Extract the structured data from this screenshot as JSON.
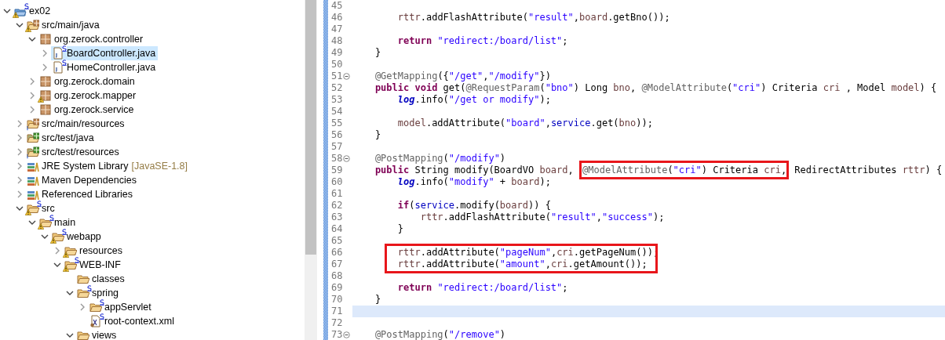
{
  "explorer": {
    "tree": [
      {
        "label": "ex02",
        "kind": "project",
        "expanded": true,
        "selected": false,
        "warning": true,
        "spring": true,
        "children": [
          {
            "label": "src/main/java",
            "kind": "source-folder",
            "expanded": true,
            "selected": false,
            "warning": true,
            "spring": false,
            "info": false,
            "children": [
              {
                "label": "org.zerock.controller",
                "kind": "package",
                "expanded": true,
                "selected": false,
                "warning": false,
                "spring": false,
                "children": [
                  {
                    "label": "BoardController.java",
                    "kind": "java-file",
                    "expanded": false,
                    "selected": true,
                    "warning": false,
                    "spring": true
                  },
                  {
                    "label": "HomeController.java",
                    "kind": "java-file",
                    "expanded": false,
                    "selected": false,
                    "warning": false,
                    "spring": true
                  }
                ]
              },
              {
                "label": "org.zerock.domain",
                "kind": "package",
                "expanded": false,
                "selected": false,
                "warning": false,
                "spring": false
              },
              {
                "label": "org.zerock.mapper",
                "kind": "package",
                "expanded": false,
                "selected": false,
                "warning": true,
                "spring": false
              },
              {
                "label": "org.zerock.service",
                "kind": "package",
                "expanded": false,
                "selected": false,
                "warning": false,
                "spring": false
              }
            ]
          },
          {
            "label": "src/main/resources",
            "kind": "source-folder",
            "expanded": false,
            "selected": false,
            "warning": false,
            "spring": false,
            "info": true
          },
          {
            "label": "src/test/java",
            "kind": "test-folder",
            "expanded": false,
            "selected": false,
            "warning": false,
            "spring": false,
            "info": false
          },
          {
            "label": "src/test/resources",
            "kind": "test-folder",
            "expanded": false,
            "selected": false,
            "warning": false,
            "spring": false,
            "info": true
          },
          {
            "label": "JRE System Library",
            "decoration": "[JavaSE-1.8]",
            "kind": "library",
            "expanded": false,
            "selected": false,
            "warning": false,
            "spring": false
          },
          {
            "label": "Maven Dependencies",
            "kind": "library",
            "expanded": false,
            "selected": false,
            "warning": false,
            "spring": false
          },
          {
            "label": "Referenced Libraries",
            "kind": "library",
            "expanded": false,
            "selected": false,
            "warning": false,
            "spring": false
          },
          {
            "label": "src",
            "kind": "folder",
            "expanded": true,
            "selected": false,
            "warning": true,
            "spring": true,
            "children": [
              {
                "label": "main",
                "kind": "folder",
                "expanded": true,
                "selected": false,
                "warning": true,
                "spring": true,
                "children": [
                  {
                    "label": "webapp",
                    "kind": "folder",
                    "expanded": true,
                    "selected": false,
                    "warning": true,
                    "spring": true,
                    "children": [
                      {
                        "label": "resources",
                        "kind": "folder",
                        "expanded": false,
                        "selected": false,
                        "warning": true,
                        "spring": false
                      },
                      {
                        "label": "WEB-INF",
                        "kind": "folder",
                        "expanded": true,
                        "selected": false,
                        "warning": true,
                        "spring": true,
                        "children": [
                          {
                            "label": "classes",
                            "kind": "folder",
                            "selected": false,
                            "warning": false,
                            "spring": false
                          },
                          {
                            "label": "spring",
                            "kind": "folder",
                            "expanded": true,
                            "selected": false,
                            "warning": false,
                            "spring": true,
                            "children": [
                              {
                                "label": "appServlet",
                                "kind": "folder",
                                "expanded": false,
                                "selected": false,
                                "warning": false,
                                "spring": true
                              },
                              {
                                "label": "root-context.xml",
                                "kind": "xml-file",
                                "selected": false,
                                "warning": false,
                                "spring": true
                              }
                            ]
                          },
                          {
                            "label": "views",
                            "kind": "folder",
                            "expanded": true,
                            "selected": false,
                            "warning": false,
                            "spring": false
                          }
                        ]
                      }
                    ]
                  }
                ]
              }
            ]
          }
        ]
      }
    ]
  },
  "editor": {
    "lines": [
      {
        "kind": "line",
        "number": "45",
        "fold": false,
        "current": false
      },
      {
        "kind": "block",
        "lines": [
          {
            "kind": "block",
            "lines": [
              {
                "kind": "line",
                "number": "46",
                "fold": false,
                "current": false,
                "tokens": [
                  {
                    "kind": "local",
                    "text": "rttr"
                  },
                  {
                    "kind": "plain",
                    "text": ".addFlashAttribute("
                  },
                  {
                    "kind": "string",
                    "text": "\"result\""
                  },
                  {
                    "kind": "plain",
                    "text": ","
                  },
                  {
                    "kind": "local",
                    "text": "board"
                  },
                  {
                    "kind": "plain",
                    "text": ".getBno());"
                  }
                ]
              },
              {
                "kind": "line",
                "number": "47",
                "fold": false,
                "current": false
              },
              {
                "kind": "line",
                "number": "48",
                "fold": false,
                "current": false,
                "tokens": [
                  {
                    "kind": "keyword",
                    "text": "return "
                  },
                  {
                    "kind": "string",
                    "text": "\"redirect:/board/list\""
                  },
                  {
                    "kind": "plain",
                    "text": ";"
                  }
                ]
              }
            ]
          },
          {
            "kind": "line",
            "number": "49",
            "fold": false,
            "current": false,
            "tokens": [
              {
                "kind": "plain",
                "text": "}"
              }
            ]
          },
          {
            "kind": "line",
            "number": "50",
            "fold": false,
            "current": false
          },
          {
            "kind": "line",
            "number": "51",
            "fold": true,
            "current": false,
            "tokens": [
              {
                "kind": "annotation",
                "text": "@GetMapping"
              },
              {
                "kind": "plain",
                "text": "({"
              },
              {
                "kind": "string",
                "text": "\"/get\""
              },
              {
                "kind": "plain",
                "text": ","
              },
              {
                "kind": "string",
                "text": "\"/modify\""
              },
              {
                "kind": "plain",
                "text": "})"
              }
            ]
          },
          {
            "kind": "line",
            "number": "52",
            "fold": false,
            "current": false,
            "tokens": [
              {
                "kind": "keyword",
                "text": "public "
              },
              {
                "kind": "keyword",
                "text": "void"
              },
              {
                "kind": "plain",
                "text": " get("
              },
              {
                "kind": "annotation",
                "text": "@RequestParam"
              },
              {
                "kind": "plain",
                "text": "("
              },
              {
                "kind": "string",
                "text": "\"bno\""
              },
              {
                "kind": "plain",
                "text": ") Long "
              },
              {
                "kind": "local",
                "text": "bno"
              },
              {
                "kind": "plain",
                "text": ", "
              },
              {
                "kind": "annotation",
                "text": "@ModelAttribute"
              },
              {
                "kind": "plain",
                "text": "("
              },
              {
                "kind": "string",
                "text": "\"cri\""
              },
              {
                "kind": "plain",
                "text": ") Criteria "
              },
              {
                "kind": "local",
                "text": "cri"
              },
              {
                "kind": "plain",
                "text": " , Model "
              },
              {
                "kind": "local",
                "text": "model"
              },
              {
                "kind": "plain",
                "text": ") {"
              }
            ]
          },
          {
            "kind": "block",
            "lines": [
              {
                "kind": "line",
                "number": "53",
                "fold": false,
                "current": false,
                "tokens": [
                  {
                    "kind": "static-field",
                    "text": "log"
                  },
                  {
                    "kind": "plain",
                    "text": ".info("
                  },
                  {
                    "kind": "string",
                    "text": "\"/get or modify\""
                  },
                  {
                    "kind": "plain",
                    "text": ");"
                  }
                ]
              },
              {
                "kind": "line",
                "number": "54",
                "fold": false,
                "current": false
              },
              {
                "kind": "line",
                "number": "55",
                "fold": false,
                "current": false,
                "tokens": [
                  {
                    "kind": "local",
                    "text": "model"
                  },
                  {
                    "kind": "plain",
                    "text": ".addAttribute("
                  },
                  {
                    "kind": "string",
                    "text": "\"board\""
                  },
                  {
                    "kind": "plain",
                    "text": ","
                  },
                  {
                    "kind": "field",
                    "text": "service"
                  },
                  {
                    "kind": "plain",
                    "text": ".get("
                  },
                  {
                    "kind": "local",
                    "text": "bno"
                  },
                  {
                    "kind": "plain",
                    "text": "));"
                  }
                ]
              }
            ]
          },
          {
            "kind": "line",
            "number": "56",
            "fold": false,
            "current": false,
            "tokens": [
              {
                "kind": "plain",
                "text": "}"
              }
            ]
          },
          {
            "kind": "line",
            "number": "57",
            "fold": false,
            "current": false
          },
          {
            "kind": "line",
            "number": "58",
            "fold": true,
            "current": false,
            "tokens": [
              {
                "kind": "annotation",
                "text": "@PostMapping"
              },
              {
                "kind": "plain",
                "text": "("
              },
              {
                "kind": "string",
                "text": "\"/modify\""
              },
              {
                "kind": "plain",
                "text": ")"
              }
            ]
          },
          {
            "kind": "line",
            "number": "59",
            "fold": false,
            "current": false,
            "tokens": [
              {
                "kind": "keyword",
                "text": "public"
              },
              {
                "kind": "plain",
                "text": " String modify(BoardVO "
              },
              {
                "kind": "local",
                "text": "board"
              },
              {
                "kind": "plain",
                "text": ", "
              },
              {
                "kind": "boxed",
                "tokens": [
                  {
                    "kind": "annotation",
                    "text": "@ModelAttribute"
                  },
                  {
                    "kind": "plain",
                    "text": "("
                  },
                  {
                    "kind": "string",
                    "text": "\"cri\""
                  },
                  {
                    "kind": "plain",
                    "text": ") Criteria "
                  },
                  {
                    "kind": "local",
                    "text": "cri"
                  },
                  {
                    "kind": "plain",
                    "text": ","
                  }
                ]
              },
              {
                "kind": "plain",
                "text": " RedirectAttributes "
              },
              {
                "kind": "local",
                "text": "rttr"
              },
              {
                "kind": "plain",
                "text": ") {"
              }
            ]
          },
          {
            "kind": "block",
            "lines": [
              {
                "kind": "line",
                "number": "60",
                "fold": false,
                "current": false,
                "tokens": [
                  {
                    "kind": "static-field",
                    "text": "log"
                  },
                  {
                    "kind": "plain",
                    "text": ".info("
                  },
                  {
                    "kind": "string",
                    "text": "\"modify\""
                  },
                  {
                    "kind": "plain",
                    "text": " + "
                  },
                  {
                    "kind": "local",
                    "text": "board"
                  },
                  {
                    "kind": "plain",
                    "text": ");"
                  }
                ]
              },
              {
                "kind": "line",
                "number": "61",
                "fold": false,
                "current": false
              },
              {
                "kind": "line",
                "number": "62",
                "fold": false,
                "current": false,
                "tokens": [
                  {
                    "kind": "keyword",
                    "text": "if"
                  },
                  {
                    "kind": "plain",
                    "text": "("
                  },
                  {
                    "kind": "field",
                    "text": "service"
                  },
                  {
                    "kind": "plain",
                    "text": ".modify("
                  },
                  {
                    "kind": "local",
                    "text": "board"
                  },
                  {
                    "kind": "plain",
                    "text": ")) {"
                  }
                ]
              },
              {
                "kind": "block",
                "lines": [
                  {
                    "kind": "line",
                    "number": "63",
                    "fold": false,
                    "current": false,
                    "tokens": [
                      {
                        "kind": "local",
                        "text": "rttr"
                      },
                      {
                        "kind": "plain",
                        "text": ".addFlashAttribute("
                      },
                      {
                        "kind": "string",
                        "text": "\"result\""
                      },
                      {
                        "kind": "plain",
                        "text": ","
                      },
                      {
                        "kind": "string",
                        "text": "\"success\""
                      },
                      {
                        "kind": "plain",
                        "text": ");"
                      }
                    ]
                  }
                ]
              },
              {
                "kind": "line",
                "number": "64",
                "fold": false,
                "current": false,
                "tokens": [
                  {
                    "kind": "plain",
                    "text": "}"
                  }
                ]
              },
              {
                "kind": "line",
                "number": "65",
                "fold": false,
                "current": false
              },
              {
                "kind": "boxed_group",
                "lines": [
                  {
                    "kind": "line",
                    "number": "66",
                    "fold": false,
                    "current": false,
                    "tokens": [
                      {
                        "kind": "local",
                        "text": "rttr"
                      },
                      {
                        "kind": "plain",
                        "text": ".addAttribute("
                      },
                      {
                        "kind": "string",
                        "text": "\"pageNum\""
                      },
                      {
                        "kind": "plain",
                        "text": ","
                      },
                      {
                        "kind": "local",
                        "text": "cri"
                      },
                      {
                        "kind": "plain",
                        "text": ".getPageNum());"
                      }
                    ]
                  },
                  {
                    "kind": "line",
                    "number": "67",
                    "fold": false,
                    "current": false,
                    "tokens": [
                      {
                        "kind": "local",
                        "text": "rttr"
                      },
                      {
                        "kind": "plain",
                        "text": ".addAttribute("
                      },
                      {
                        "kind": "string",
                        "text": "\"amount\""
                      },
                      {
                        "kind": "plain",
                        "text": ","
                      },
                      {
                        "kind": "local",
                        "text": "cri"
                      },
                      {
                        "kind": "plain",
                        "text": ".getAmount());"
                      }
                    ]
                  }
                ]
              },
              {
                "kind": "line",
                "number": "68",
                "fold": false,
                "current": false
              },
              {
                "kind": "line",
                "number": "69",
                "fold": false,
                "current": false,
                "tokens": [
                  {
                    "kind": "keyword",
                    "text": "return "
                  },
                  {
                    "kind": "string",
                    "text": "\"redirect:/board/list\""
                  },
                  {
                    "kind": "plain",
                    "text": ";"
                  }
                ]
              }
            ]
          },
          {
            "kind": "line",
            "number": "70",
            "fold": false,
            "current": false,
            "tokens": [
              {
                "kind": "plain",
                "text": "}"
              }
            ]
          },
          {
            "kind": "line",
            "number": "71",
            "fold": false,
            "current": true
          },
          {
            "kind": "line",
            "number": "72",
            "fold": false,
            "current": false
          },
          {
            "kind": "line",
            "number": "73",
            "fold": true,
            "current": false,
            "tokens": [
              {
                "kind": "annotation",
                "text": "@PostMapping"
              },
              {
                "kind": "plain",
                "text": "("
              },
              {
                "kind": "string",
                "text": "\"/remove\""
              },
              {
                "kind": "plain",
                "text": ")"
              }
            ]
          }
        ]
      }
    ]
  }
}
